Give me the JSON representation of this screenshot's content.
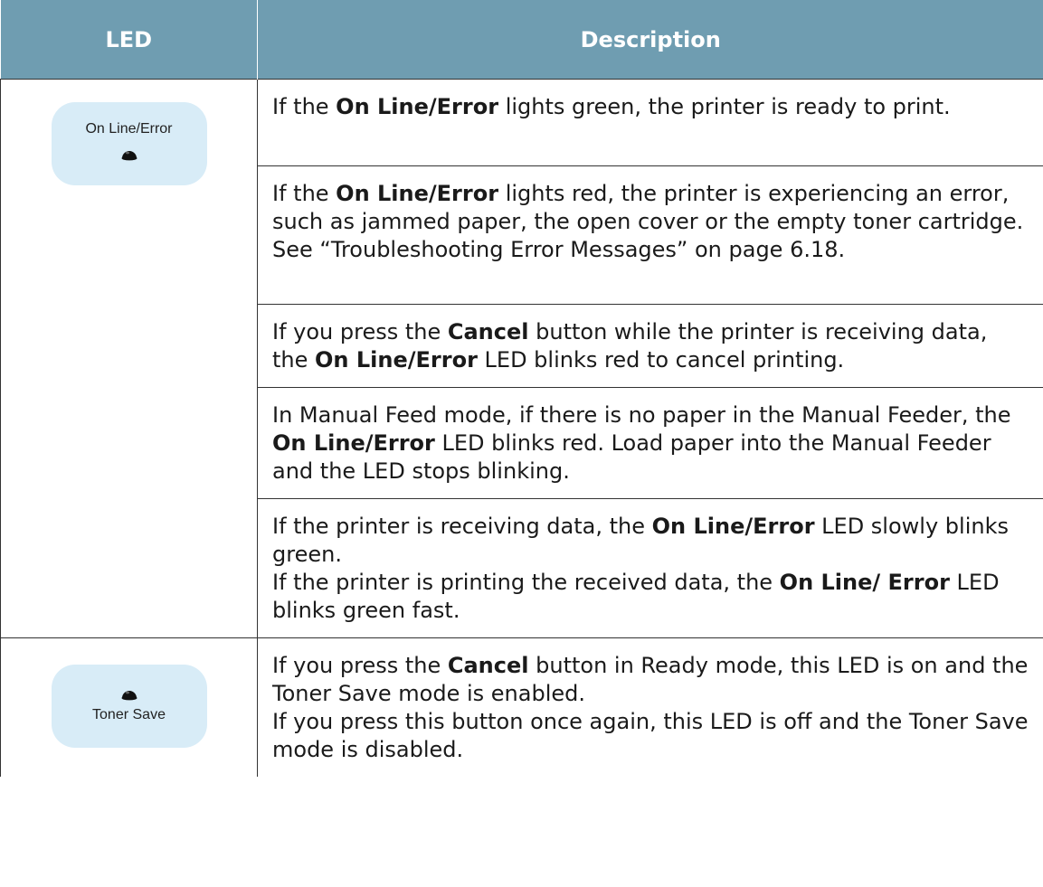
{
  "table": {
    "headers": {
      "led": "LED",
      "description": "Description"
    },
    "led_online": {
      "label": "On Line/Error",
      "icon": "led-dot-icon"
    },
    "led_toner": {
      "label": "Toner Save",
      "icon": "led-dot-icon"
    },
    "rows": [
      {
        "segments": [
          {
            "t": "If the ",
            "b": false
          },
          {
            "t": "On Line/Error",
            "b": true
          },
          {
            "t": " lights green, the printer is ready to print.",
            "b": false
          }
        ]
      },
      {
        "segments": [
          {
            "t": "If the ",
            "b": false
          },
          {
            "t": "On Line/Error",
            "b": true
          },
          {
            "t": " lights red, the printer is experiencing an error, such as jammed paper, the open cover or the empty toner cartridge. See “Troubleshooting Error Messages” on page 6.18.",
            "b": false
          }
        ]
      },
      {
        "segments": [
          {
            "t": "If you press the ",
            "b": false
          },
          {
            "t": "Cancel",
            "b": true
          },
          {
            "t": " button while the printer is receiving data, the ",
            "b": false
          },
          {
            "t": "On Line/Error",
            "b": true
          },
          {
            "t": " LED blinks red to cancel printing.",
            "b": false
          }
        ]
      },
      {
        "segments": [
          {
            "t": "In Manual Feed mode, if there is no paper in the Manual Feeder, the ",
            "b": false
          },
          {
            "t": "On Line/Error",
            "b": true
          },
          {
            "t": " LED blinks red. Load paper into the Manual Feeder and the LED stops blinking.",
            "b": false
          }
        ]
      },
      {
        "segments": [
          {
            "t": "If the printer is receiving data, the ",
            "b": false
          },
          {
            "t": "On Line/Error",
            "b": true
          },
          {
            "t": " LED slowly blinks green.",
            "b": false
          },
          {
            "br": true
          },
          {
            "t": "If the printer is printing the received data, the ",
            "b": false
          },
          {
            "t": "On Line/ Error",
            "b": true
          },
          {
            "t": " LED blinks green fast.",
            "b": false
          }
        ]
      },
      {
        "segments": [
          {
            "t": "If you press the ",
            "b": false
          },
          {
            "t": "Cancel",
            "b": true
          },
          {
            "t": " button in Ready mode, this LED is on and the Toner Save mode is enabled.",
            "b": false
          },
          {
            "br": true
          },
          {
            "t": "If you press this button once again, this LED is off and the Toner Save mode is disabled.",
            "b": false
          }
        ]
      }
    ]
  }
}
